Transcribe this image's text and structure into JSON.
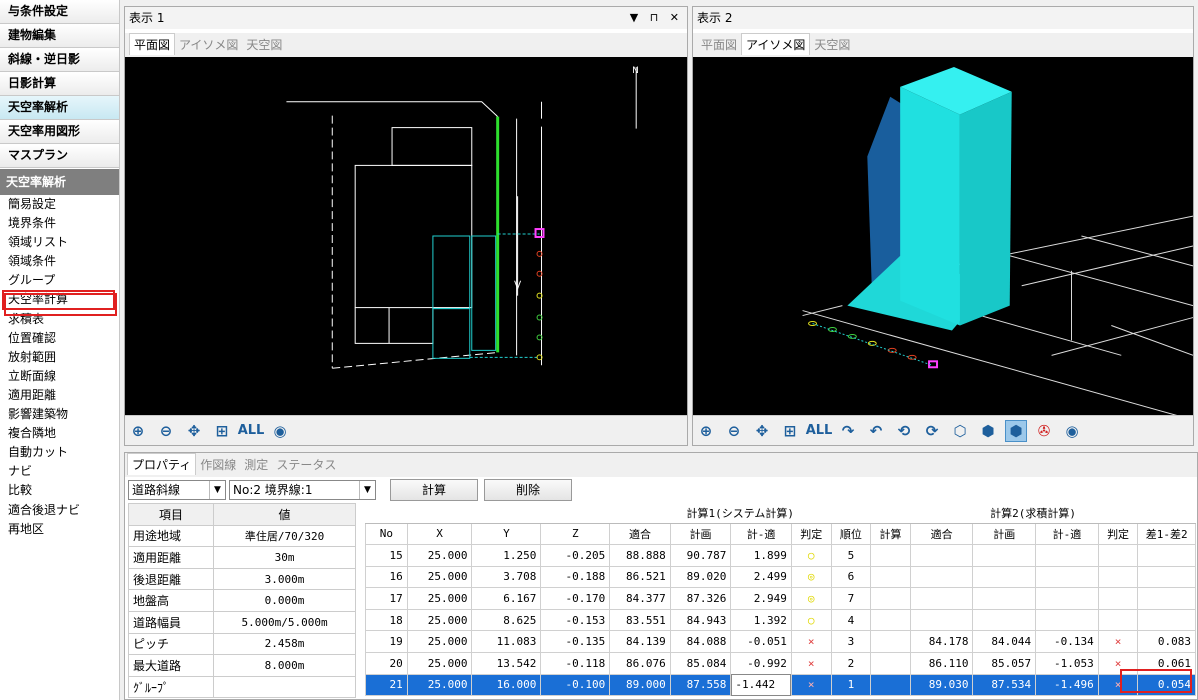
{
  "sidebar": {
    "nav": [
      "与条件設定",
      "建物編集",
      "斜線・逆日影",
      "日影計算",
      "天空率解析",
      "天空率用図形",
      "マスプラン"
    ],
    "section_header": "天空率解析",
    "items": [
      "簡易設定",
      "境界条件",
      "領域リスト",
      "領域条件",
      "グループ",
      "天空率計算",
      "求積表",
      "位置確認",
      "放射範囲",
      "立断面線",
      "適用距離",
      "影響建築物",
      "複合隣地",
      "自動カット",
      "ナビ",
      "比較",
      "適合後退ナビ",
      "再地区"
    ]
  },
  "view1": {
    "title": "表示 1",
    "window_buttons": "▼ ⊓ ✕",
    "tabs": [
      "平面図",
      "アイソメ図",
      "天空図"
    ],
    "north": "N"
  },
  "view2": {
    "title": "表示 2",
    "tabs": [
      "平面図",
      "アイソメ図",
      "天空図"
    ]
  },
  "toolbar": {
    "all_label": "ALL"
  },
  "bottom": {
    "tabs": [
      "プロパティ",
      "作図線",
      "測定",
      "ステータス"
    ],
    "select1": "道路斜線",
    "select2": "No:2 境界線:1",
    "calc_button": "計算",
    "delete_button": "削除",
    "props_header": [
      "項目",
      "値"
    ],
    "props": [
      [
        "用途地域",
        "準住居/70/320"
      ],
      [
        "適用距離",
        "30m"
      ],
      [
        "後退距離",
        "3.000m"
      ],
      [
        "地盤高",
        "0.000m"
      ],
      [
        "道路幅員",
        "5.000m/5.000m"
      ],
      [
        "ピッチ",
        "2.458m"
      ],
      [
        "最大道路",
        "8.000m"
      ],
      [
        "ｸﾞﾙｰﾌﾟ",
        ""
      ]
    ]
  },
  "grid": {
    "group1": "計算1(システム計算)",
    "group2": "計算2(求積計算)",
    "headers": [
      "No",
      "X",
      "Y",
      "Z",
      "適合",
      "計画",
      "計-適",
      "判定",
      "順位",
      "計算",
      "適合",
      "計画",
      "計-適",
      "判定",
      "差1-差2"
    ],
    "rows": [
      [
        "15",
        "25.000",
        "1.250",
        "-0.205",
        "88.888",
        "90.787",
        "1.899",
        "○",
        "5",
        "",
        "",
        "",
        "",
        "",
        ""
      ],
      [
        "16",
        "25.000",
        "3.708",
        "-0.188",
        "86.521",
        "89.020",
        "2.499",
        "◎",
        "6",
        "",
        "",
        "",
        "",
        "",
        ""
      ],
      [
        "17",
        "25.000",
        "6.167",
        "-0.170",
        "84.377",
        "87.326",
        "2.949",
        "◎",
        "7",
        "",
        "",
        "",
        "",
        "",
        ""
      ],
      [
        "18",
        "25.000",
        "8.625",
        "-0.153",
        "83.551",
        "84.943",
        "1.392",
        "○",
        "4",
        "",
        "",
        "",
        "",
        "",
        ""
      ],
      [
        "19",
        "25.000",
        "11.083",
        "-0.135",
        "84.139",
        "84.088",
        "-0.051",
        "×",
        "3",
        "",
        "84.178",
        "84.044",
        "-0.134",
        "×",
        "0.083"
      ],
      [
        "20",
        "25.000",
        "13.542",
        "-0.118",
        "86.076",
        "85.084",
        "-0.992",
        "×",
        "2",
        "",
        "86.110",
        "85.057",
        "-1.053",
        "×",
        "0.061"
      ],
      [
        "21",
        "25.000",
        "16.000",
        "-0.100",
        "89.000",
        "87.558",
        "-1.442",
        "×",
        "1",
        "",
        "89.030",
        "87.534",
        "-1.496",
        "×",
        "0.054"
      ]
    ],
    "selected_row": "21"
  }
}
